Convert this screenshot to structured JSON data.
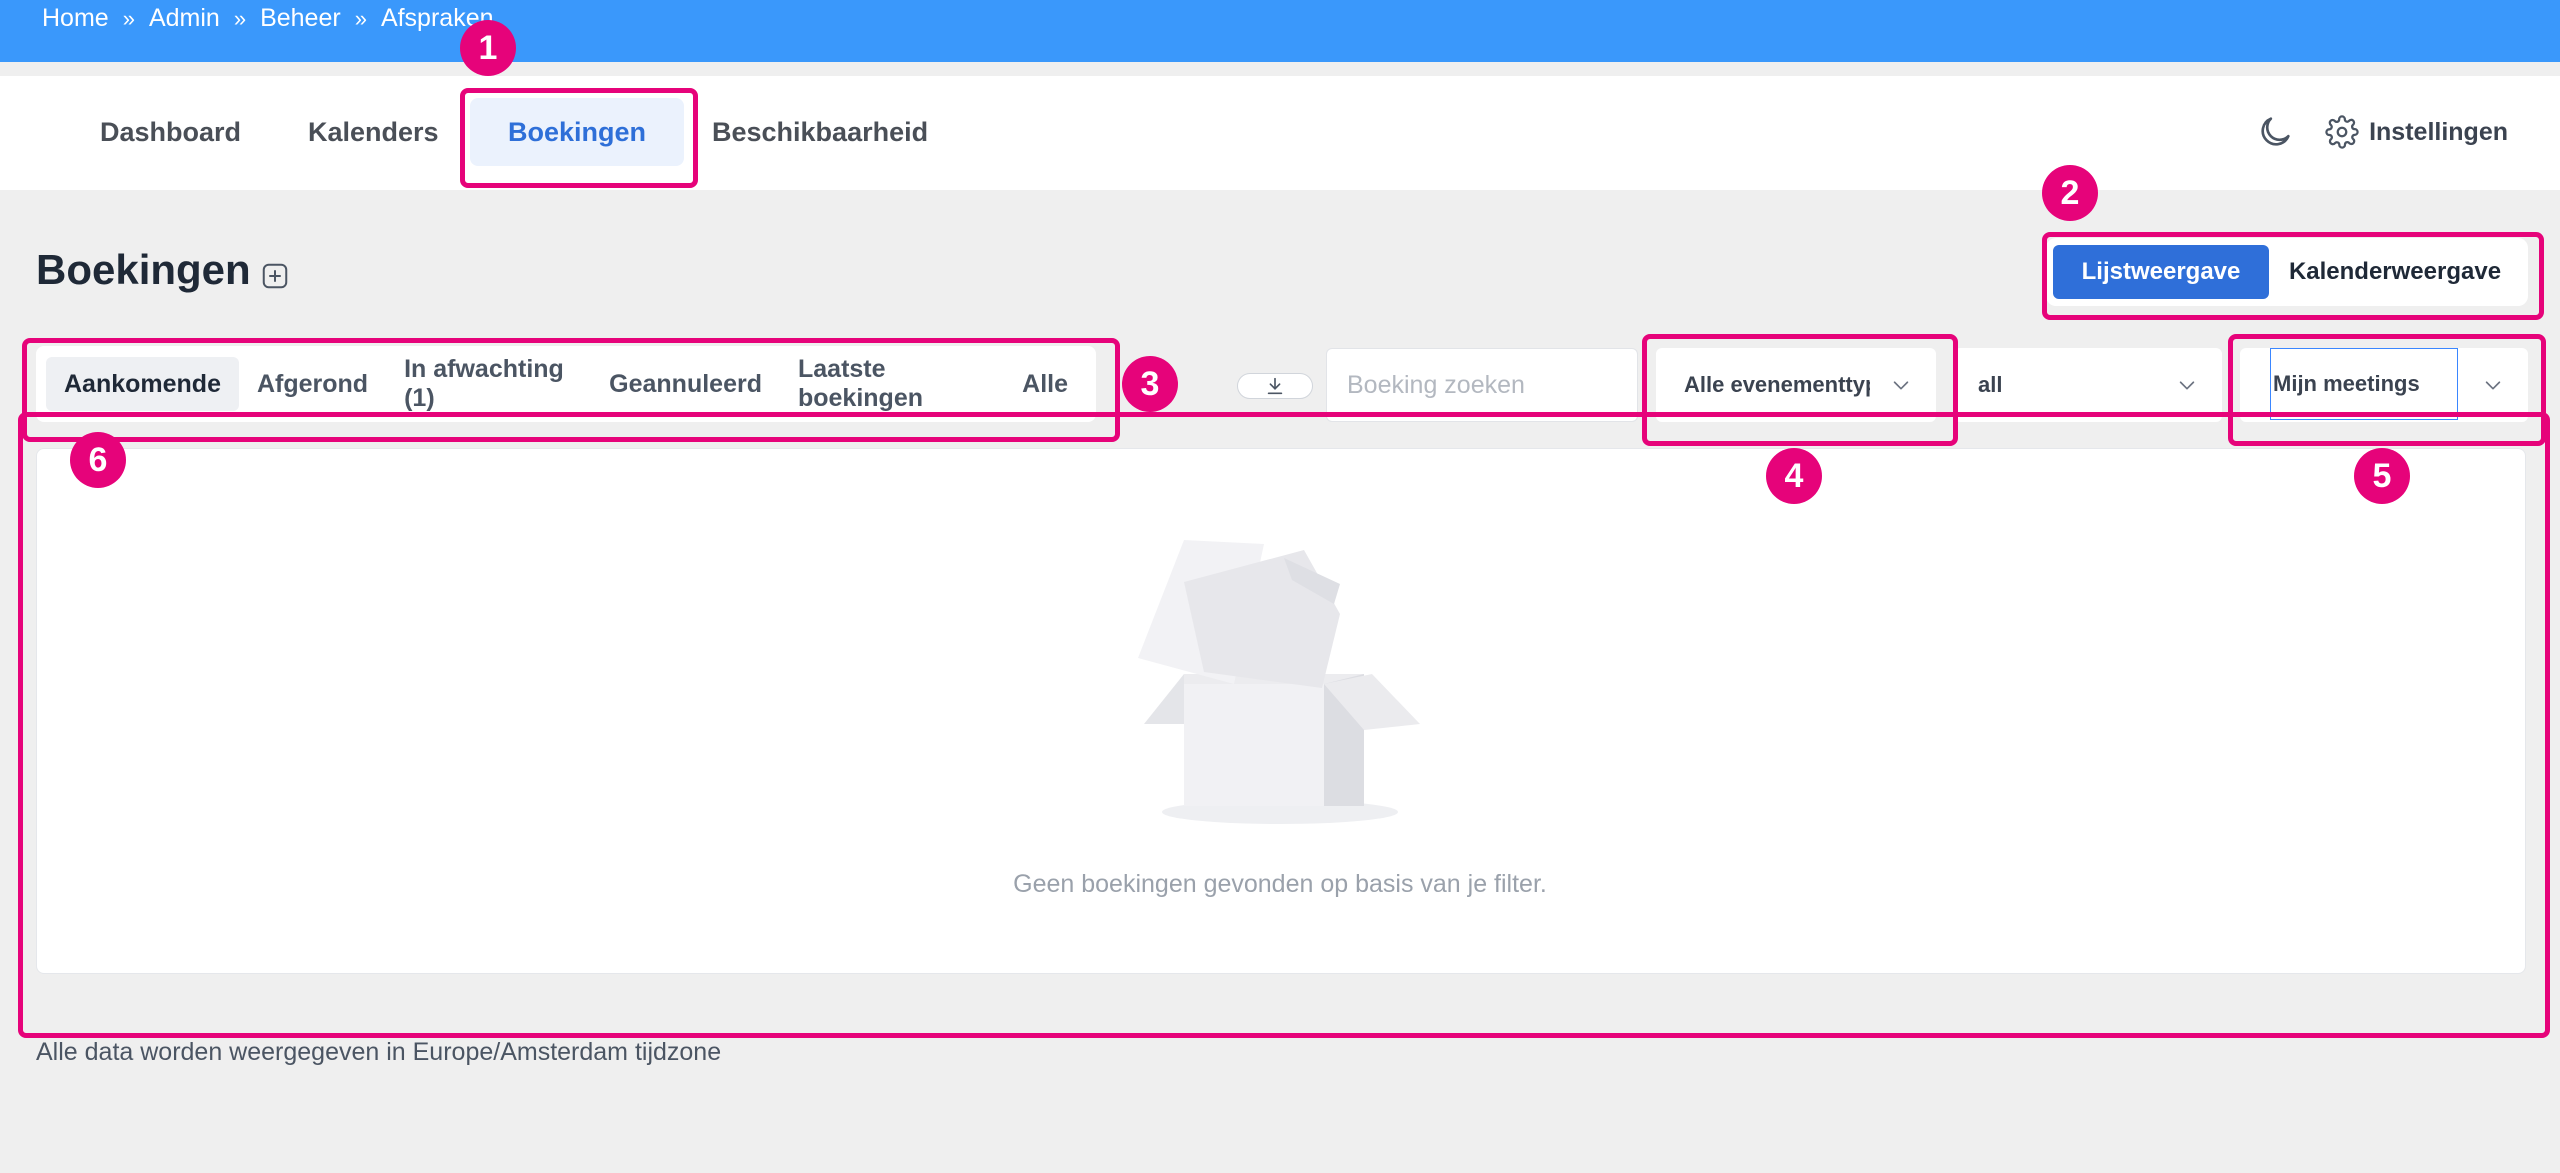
{
  "breadcrumb": [
    "Home",
    "Admin",
    "Beheer",
    "Afspraken"
  ],
  "breadcrumb_sep": "»",
  "nav": {
    "tabs": [
      "Dashboard",
      "Kalenders",
      "Boekingen",
      "Beschikbaarheid"
    ],
    "active_tab": "Boekingen",
    "settings_label": "Instellingen"
  },
  "page": {
    "title": "Boekingen"
  },
  "view_toggle": {
    "list_label": "Lijstweergave",
    "calendar_label": "Kalenderweergave",
    "active": "Lijstweergave"
  },
  "filters": {
    "tabs": [
      "Aankomende",
      "Afgerond",
      "In afwachting (1)",
      "Geannuleerd",
      "Laatste boekingen",
      "Alle"
    ],
    "active_tab": "Aankomende",
    "search_placeholder": "Boeking zoeken",
    "event_type_select": "Alle evenementtypes",
    "status_select": "all",
    "owner_select": "Mijn meetings"
  },
  "empty_state": {
    "message": "Geen boekingen gevonden op basis van je filter."
  },
  "footer_note": "Alle data worden weergegeven in Europe/Amsterdam tijdzone",
  "annotations": [
    "1",
    "2",
    "3",
    "4",
    "5",
    "6"
  ],
  "colors": {
    "topbar": "#3a98fb",
    "primary": "#2f6fd9",
    "annotation": "#e6037a"
  }
}
